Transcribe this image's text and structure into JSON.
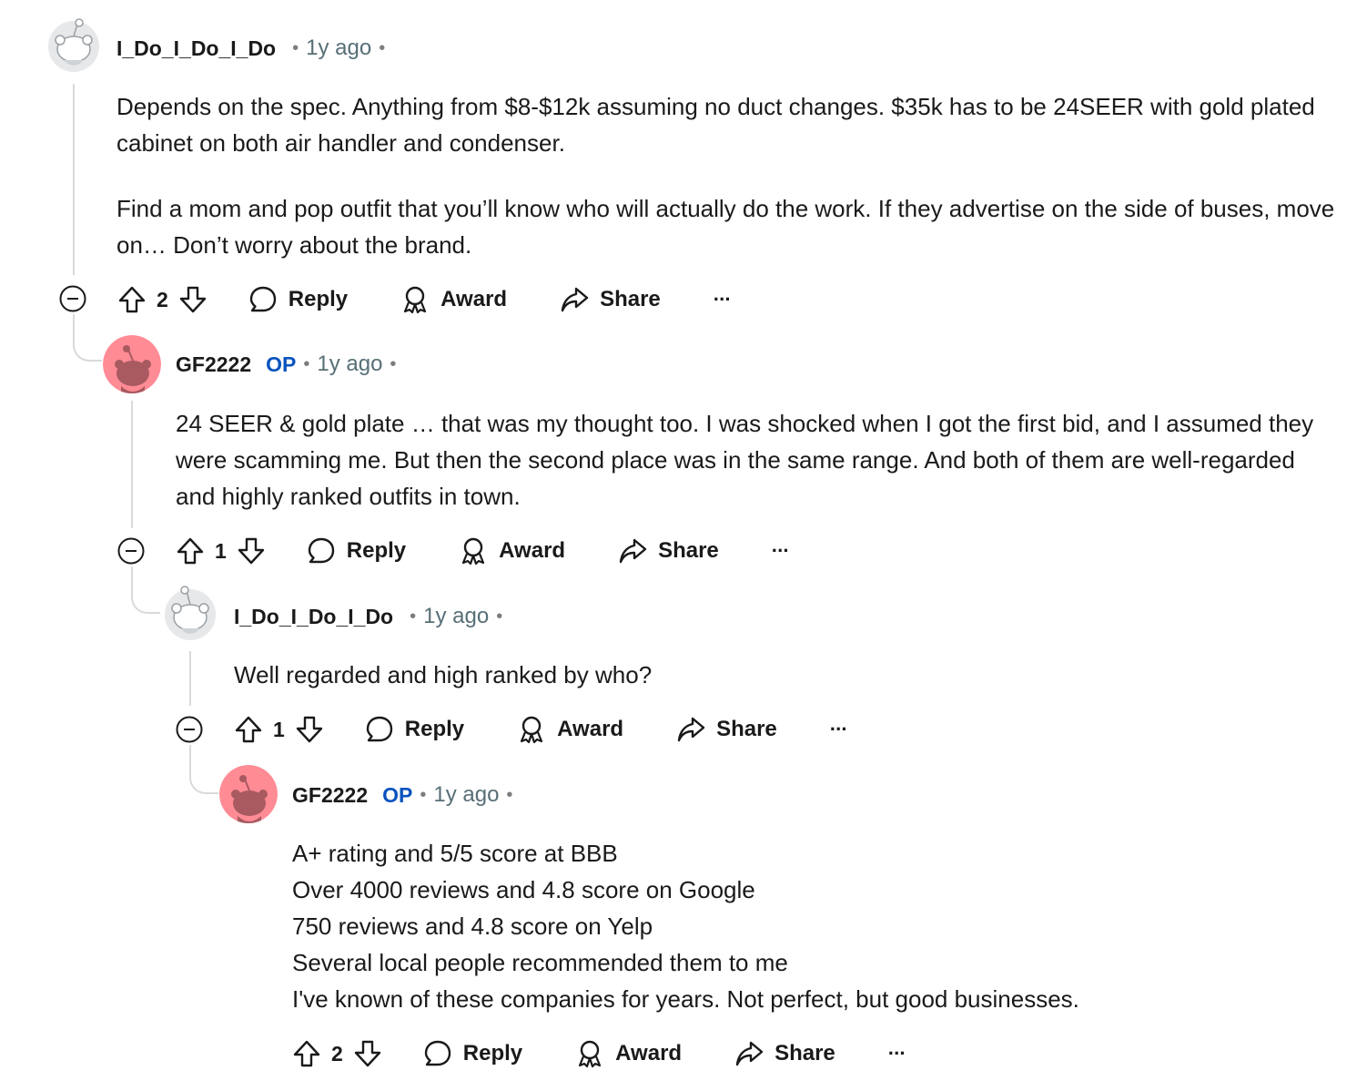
{
  "comments": [
    {
      "username": "I_Do_I_Do_I_Do",
      "op_badge": "",
      "time": "1y ago",
      "avatar_icon": "snoo-grey-avatar-icon",
      "paragraphs": [
        "Depends on the spec. Anything from $8-$12k assuming no duct changes. $35k has to be 24SEER with gold plated cabinet on both air handler and condenser.",
        "Find a mom and pop outfit that you’ll know who will actually do the work. If they advertise on the side of buses, move on… Don’t worry about the brand."
      ],
      "votes": "2"
    },
    {
      "username": "GF2222",
      "op_badge": "OP",
      "time": "1y ago",
      "avatar_icon": "snoo-pink-avatar-icon",
      "paragraphs": [
        "24 SEER & gold plate … that was my thought too. I was shocked when I got the first bid, and I assumed they were scamming me. But then the second place was in the same range. And both of them are well-regarded and highly ranked outfits in town."
      ],
      "votes": "1"
    },
    {
      "username": "I_Do_I_Do_I_Do",
      "op_badge": "",
      "time": "1y ago",
      "avatar_icon": "snoo-grey-avatar-icon",
      "paragraphs": [
        "Well regarded and high ranked by who?"
      ],
      "votes": "1"
    },
    {
      "username": "GF2222",
      "op_badge": "OP",
      "time": "1y ago",
      "avatar_icon": "snoo-pink-avatar-icon",
      "paragraphs": [
        "A+ rating and 5/5 score at BBB",
        "Over 4000 reviews and 4.8 score on Google",
        "750 reviews and 4.8 score on Yelp",
        "Several local people recommended them to me",
        "I've known of these companies for years. Not perfect, but good businesses."
      ],
      "votes": "2"
    }
  ],
  "actions": {
    "reply": "Reply",
    "award": "Award",
    "share": "Share",
    "more": "···"
  },
  "separator": "•",
  "colors": {
    "op_blue": "#0a53be",
    "thread_line": "#d7dadc",
    "pink_avatar": "#ff8b95",
    "text": "#1a1a1b"
  }
}
